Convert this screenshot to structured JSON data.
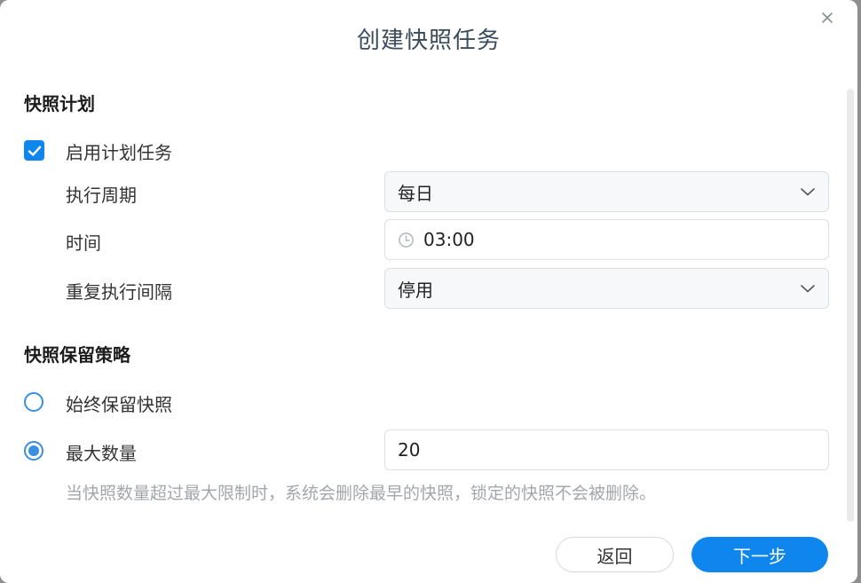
{
  "dialog": {
    "title": "创建快照任务",
    "close_icon": "close-icon"
  },
  "schedule": {
    "section_title": "快照计划",
    "enable_label": "启用计划任务",
    "enable_checked": true,
    "cycle": {
      "label": "执行周期",
      "value": "每日"
    },
    "time": {
      "label": "时间",
      "value": "03:00"
    },
    "repeat": {
      "label": "重复执行间隔",
      "value": "停用"
    }
  },
  "retention": {
    "section_title": "快照保留策略",
    "options": [
      {
        "label": "始终保留快照",
        "selected": false
      },
      {
        "label": "最大数量",
        "selected": true,
        "value": "20"
      }
    ],
    "hint": "当快照数量超过最大限制时，系统会删除最早的快照，锁定的快照不会被删除。"
  },
  "footer": {
    "back_label": "返回",
    "next_label": "下一步"
  },
  "colors": {
    "accent": "#0e86ee",
    "radio": "#3a8fe0",
    "hint": "#a3a7ab"
  }
}
